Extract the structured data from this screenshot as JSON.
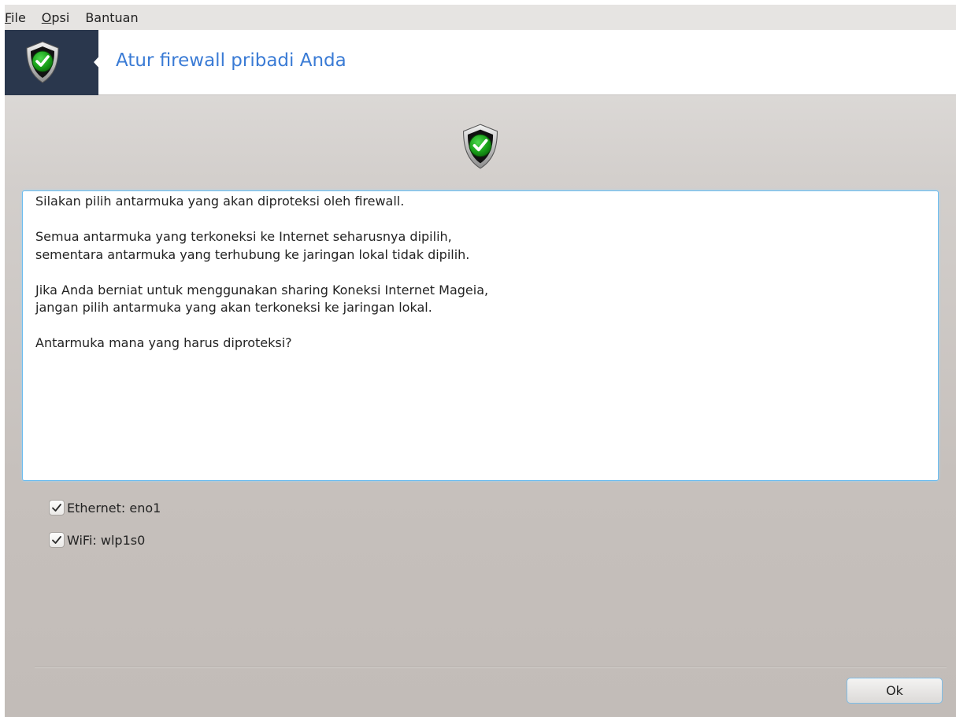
{
  "menubar": {
    "items": [
      {
        "accel": "F",
        "rest": "ile"
      },
      {
        "accel": "O",
        "rest": "psi"
      },
      {
        "accel": "",
        "rest": "Bantuan"
      }
    ]
  },
  "header": {
    "title": "Atur firewall pribadi Anda",
    "icon": "shield-check-icon"
  },
  "main": {
    "icon": "shield-check-icon",
    "description": [
      "Silakan pilih antarmuka yang akan diproteksi oleh firewall.",
      "Semua antarmuka yang terkoneksi ke Internet seharusnya dipilih,\nsementara antarmuka yang terhubung ke jaringan lokal tidak dipilih.",
      "Jika Anda berniat untuk menggunakan sharing Koneksi Internet Mageia,\njangan pilih antarmuka yang akan terkoneksi ke jaringan lokal.",
      "Antarmuka mana yang harus diproteksi?"
    ],
    "interfaces": [
      {
        "label": "Ethernet: eno1",
        "checked": true
      },
      {
        "label": "WiFi: wlp1s0",
        "checked": true
      }
    ]
  },
  "footer": {
    "ok_label": "Ok"
  },
  "colors": {
    "accent": "#3a7bd5",
    "header_bg": "#2a374d",
    "shield_green": "#1fa51f"
  }
}
